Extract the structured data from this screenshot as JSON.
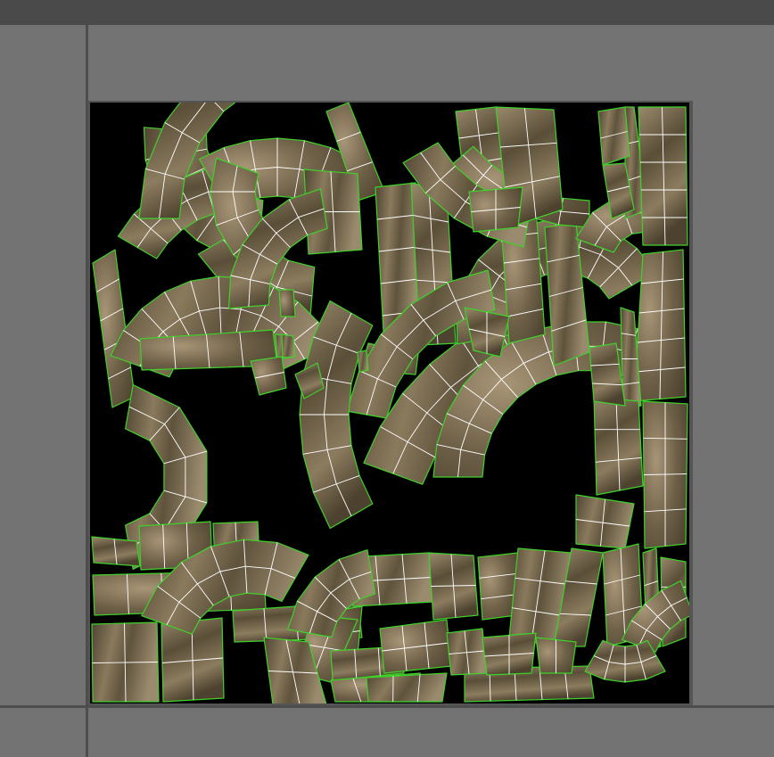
{
  "window": {
    "title": ""
  },
  "uv_editor": {
    "texture": "wood-bark",
    "colors": {
      "background": "#737373",
      "topbar": "#4a4a4a",
      "axis": "#4d4d4d",
      "canvas": "#000000",
      "shell_outline": "#3fd12a",
      "edge": "#ffffff",
      "wood_dark": "#4a3f2c",
      "wood_mid": "#7b6c50",
      "wood_light": "#a89880"
    },
    "shell_count": 70
  }
}
